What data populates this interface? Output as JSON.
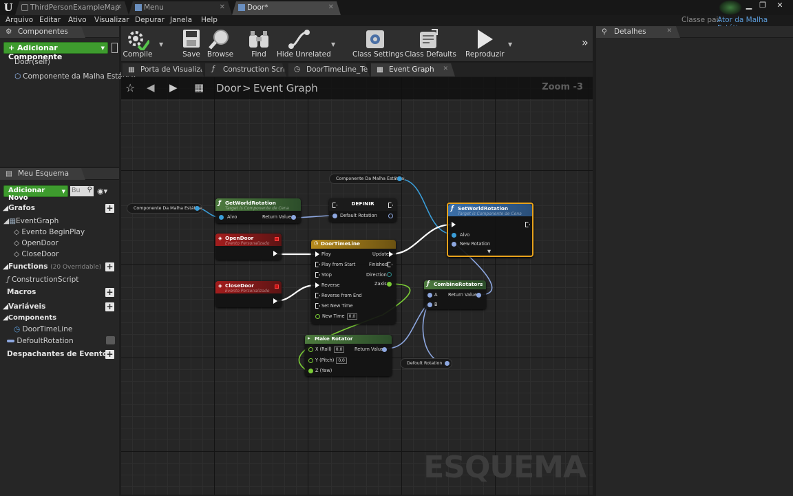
{
  "window": {
    "tabs": [
      {
        "label": "ThirdPersonExampleMap"
      },
      {
        "label": "Menu"
      },
      {
        "label": "Door*"
      }
    ],
    "parent_class_label": "Classe pai:",
    "parent_class_value": "Ator da Malha Estática"
  },
  "menu": [
    "Arquivo",
    "Editar",
    "Ativo",
    "Visualizar",
    "Depurar",
    "Janela",
    "Help"
  ],
  "components": {
    "title": "Componentes",
    "add_button": "+ Adicionar Componente",
    "items": [
      "Door(self)",
      "Componente da Malha Estática"
    ]
  },
  "myblueprint": {
    "title": "Meu Esquema",
    "add_new": "Adicionar Novo",
    "search_placeholder": "Bu",
    "sections": {
      "graphs": "Grafos",
      "functions": "Functions",
      "functions_count": "(20 Overridable)",
      "macros": "Macros",
      "variables": "Variáveis",
      "components": "Components",
      "dispatchers": "Despachantes de Evento"
    },
    "graph_items": [
      "EventGraph",
      "Evento BeginPlay",
      "OpenDoor",
      "CloseDoor"
    ],
    "function_items": [
      "ConstructionScript"
    ],
    "component_items": [
      "DoorTimeLine"
    ],
    "variable_items": [
      "DefoultRotation"
    ]
  },
  "toolbar": {
    "compile": "Compile",
    "save": "Save",
    "browse": "Browse",
    "find": "Find",
    "hide_unrelated": "Hide Unrelated",
    "class_settings": "Class Settings",
    "class_defaults": "Class Defaults",
    "play": "Reproduzir"
  },
  "editor_tabs": [
    "Porta de Visualiza",
    "Construction Scrip",
    "DoorTimeLine_Ten",
    "Event Graph"
  ],
  "breadcrumb": {
    "root": "Door",
    "sep": ">",
    "current": "Event Graph"
  },
  "zoom": "Zoom -3",
  "watermark": "ESQUEMA",
  "details": {
    "title": "Detalhes"
  },
  "graph": {
    "var_mesh_1": "Componente Da Malha Estática",
    "var_mesh_2": "Componente Da Malha Estática",
    "get_world_rotation": {
      "title": "GetWorldRotation",
      "sub": "Target is Componente de Cena",
      "in": "Alvo",
      "out": "Return Value"
    },
    "definir": {
      "title": "DEFINIR",
      "pin": "Default Rotation"
    },
    "set_world_rotation": {
      "title": "SetWorldRotation",
      "sub": "Target is Componente de Cena",
      "alvo": "Alvo",
      "new_rot": "New Rotation"
    },
    "open_door": {
      "title": "OpenDoor",
      "sub": "Evento Personalizado"
    },
    "close_door": {
      "title": "CloseDoor",
      "sub": "Evento Personalizado"
    },
    "timeline": {
      "title": "DoorTimeLine",
      "pins_in": [
        "Play",
        "Play from Start",
        "Stop",
        "Reverse",
        "Reverse from End",
        "Set New Time",
        "New Time"
      ],
      "new_time_val": "0,0",
      "pins_out": [
        "Update",
        "Finished",
        "Direction",
        "Zaxis"
      ]
    },
    "combine": {
      "title": "CombineRotators",
      "a": "A",
      "b": "B",
      "out": "Return Value"
    },
    "make_rot": {
      "title": "Make Rotator",
      "x": "X (Roll)",
      "y": "Y (Pitch)",
      "z": "Z (Yaw)",
      "x_val": "0,0",
      "y_val": "0,0",
      "out": "Return Value"
    },
    "default_rot_var": "Defoult Rotation"
  }
}
